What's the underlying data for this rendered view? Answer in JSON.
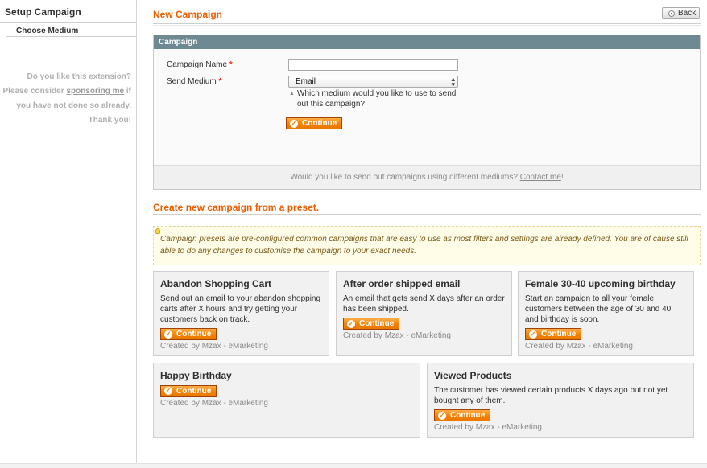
{
  "sidebar": {
    "title": "Setup Campaign",
    "tab": "Choose Medium",
    "message": {
      "line1": "Do you like this extension?",
      "line2_pre": "Please consider ",
      "line2_link": "sponsoring me",
      "line2_post": " if",
      "line3": "you have not done so already.",
      "line4": "Thank you!"
    }
  },
  "header": {
    "title": "New Campaign",
    "back_label": "Back"
  },
  "form": {
    "section_label": "Campaign",
    "name_label": "Campaign Name",
    "name_value": "",
    "medium_label": "Send Medium",
    "required_mark": "*",
    "medium_value": "Email",
    "medium_hint": "Which medium would you like to use to send out this campaign?",
    "continue_label": "Continue",
    "footer_text": "Would you like to send out campaigns using different mediums? ",
    "footer_link": "Contact me",
    "footer_suffix": "!"
  },
  "presets": {
    "title": "Create new campaign from a preset.",
    "notice": "Campaign presets are pre-configured common campaigns that are easy to use as most filters and settings are already defined. You are of cause still able to do any changes to customise the campaign to your exact needs.",
    "continue_label": "Continue",
    "credit": "Created by Mzax - eMarketing",
    "cards": [
      {
        "title": "Abandon Shopping Cart",
        "desc": "Send out an email to your abandon shopping carts after X hours and try getting your customers back on track."
      },
      {
        "title": "After order shipped email",
        "desc": "An email that gets send X days after an order has been shipped."
      },
      {
        "title": "Female 30-40 upcoming birthday",
        "desc": "Start an campaign to all your female customers between the age of 30 and 40 and birthday is soon."
      },
      {
        "title": "Happy Birthday",
        "desc": ""
      },
      {
        "title": "Viewed Products",
        "desc": "The customer has viewed certain products X days ago but not yet bought any of them."
      }
    ]
  },
  "colors": {
    "accent": "#eb5e00",
    "button": "#f18200",
    "section_header": "#6f8992"
  }
}
